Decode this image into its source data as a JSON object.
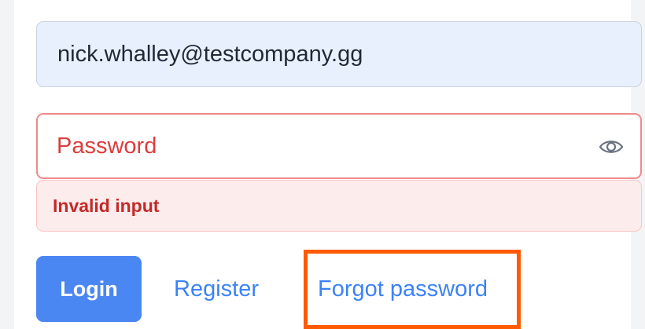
{
  "form": {
    "email_value": "nick.whalley@testcompany.gg",
    "password_placeholder": "Password",
    "show_password_icon": "eye-icon",
    "error_message": "Invalid input",
    "login_label": "Login",
    "register_label": "Register",
    "forgot_password_label": "Forgot password"
  },
  "colors": {
    "primary": "#4b87f3",
    "link": "#3b82f6",
    "error_text": "#c62828",
    "error_border": "#f08a8a",
    "error_bg": "#fdecec",
    "autofill_bg": "#e8f0fe",
    "highlight": "#ff5a00"
  }
}
